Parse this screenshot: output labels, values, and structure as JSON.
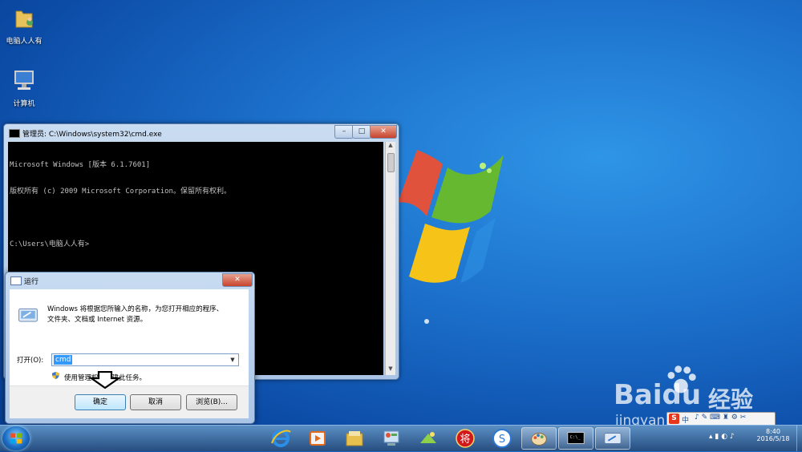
{
  "desktop": {
    "icons": [
      {
        "label": "电脑人人有",
        "icon": "user-folder-icon"
      },
      {
        "label": "计算机",
        "icon": "computer-icon"
      }
    ]
  },
  "cmd_window": {
    "title": "管理员: C:\\Windows\\system32\\cmd.exe",
    "controls": {
      "minimize": "–",
      "maximize": "□",
      "close": "✕"
    },
    "lines": [
      "Microsoft Windows [版本 6.1.7601]",
      "版权所有 (c) 2009 Microsoft Corporation。保留所有权利。",
      "",
      "C:\\Users\\电脑人人有>"
    ]
  },
  "run_dialog": {
    "title": "运行",
    "close": "✕",
    "description_line1": "Windows 将根据您所输入的名称，为您打开相应的程序、",
    "description_line2": "文件夹、文档或 Internet 资源。",
    "open_label": "打开(O):",
    "open_value": "cmd",
    "admin_note": "使用管理权限创建此任务。",
    "buttons": {
      "ok": "确定",
      "cancel": "取消",
      "browse": "浏览(B)..."
    }
  },
  "taskbar": {
    "pinned": [
      "ie-icon",
      "media-player-icon",
      "explorer-icon",
      "control-panel-icon",
      "photos-icon",
      "chess-icon",
      "sogou-icon",
      "paint-icon",
      "cmd-icon",
      "run-icon"
    ],
    "ime_label": "中",
    "clock_time": "8:40",
    "clock_date": "2016/5/18"
  },
  "watermark": {
    "brand": "Baidu",
    "suffix": "经验",
    "url": "jingyan.baidu.com"
  },
  "colors": {
    "desktop": "#1b6fca",
    "selection": "#3399ff",
    "close_red": "#c7432c"
  }
}
